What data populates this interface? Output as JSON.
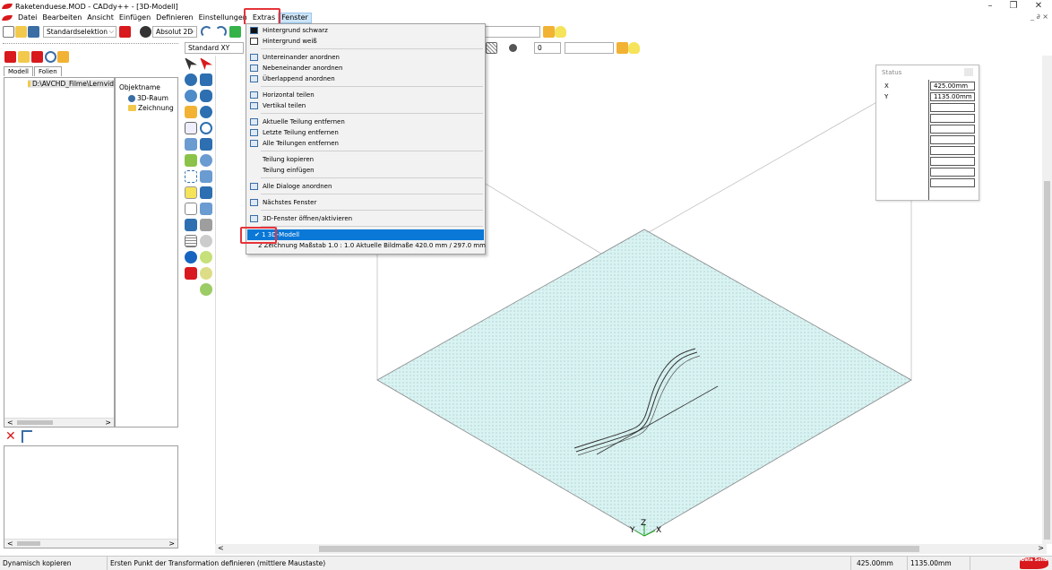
{
  "window": {
    "title": "Raketenduese.MOD  -  CADdy++ - [3D-Modell]",
    "minimize": "–",
    "maximize": "❐",
    "close": "✕",
    "mdi_controls": "_ ∂ ×"
  },
  "menubar": {
    "items": [
      "Datei",
      "Bearbeiten",
      "Ansicht",
      "Einfügen",
      "Definieren",
      "Einstellungen",
      "Extras",
      "Fenster"
    ]
  },
  "toolbar": {
    "selection_combo": "Standardselektion",
    "coord_combo": "Absolut 2D",
    "view_combo": "Standard XY",
    "layer_value": "0"
  },
  "left_panel": {
    "tabs": [
      "Modell",
      "Folien"
    ],
    "root_path": "D:\\AVCHD_Filme\\Lernvid",
    "object_header": "Objektname",
    "objects": [
      "3D-Raum",
      "Zeichnung"
    ],
    "scroll_left": "<",
    "scroll_right": ">"
  },
  "fenster_menu": {
    "items": [
      {
        "label": "Hintergrund schwarz"
      },
      {
        "label": "Hintergrund weiß"
      },
      {
        "label": "Untereinander anordnen"
      },
      {
        "label": "Nebeneinander anordnen"
      },
      {
        "label": "Überlappend anordnen"
      },
      {
        "label": "Horizontal teilen"
      },
      {
        "label": "Vertikal teilen"
      },
      {
        "label": "Aktuelle Teilung entfernen"
      },
      {
        "label": "Letzte Teilung entfernen"
      },
      {
        "label": "Alle Teilungen entfernen"
      },
      {
        "label": "Teilung kopieren"
      },
      {
        "label": "Teilung einfügen"
      },
      {
        "label": "Alle Dialoge anordnen"
      },
      {
        "label": "Nächstes Fenster"
      },
      {
        "label": "3D-Fenster öffnen/aktivieren"
      },
      {
        "label": "1 3D-Modell"
      },
      {
        "label": "2 Zeichnung    Maßstab 1.0 : 1.0   Aktuelle Bildmaße 420.0 mm / 297.0 mm"
      }
    ],
    "checkmark": "✔"
  },
  "status_panel": {
    "title": "Status",
    "x_label": "X",
    "x_value": "425.00mm",
    "y_label": "Y",
    "y_value": "1135.00mm"
  },
  "axes": {
    "x": "X",
    "y": "Y",
    "z": "Z"
  },
  "statusbar": {
    "mode": "Dynamisch kopieren",
    "prompt": "Ersten Punkt der Transformation definieren (mittlere Maustaste)",
    "x": "425.00mm",
    "y": "1135.00mm",
    "logo": "Data Solid"
  },
  "colors": {
    "accent": "#0a78d7",
    "highlight_box": "#e5343a",
    "plane_fill": "#d9f2f2",
    "brand_red": "#d8191d"
  }
}
